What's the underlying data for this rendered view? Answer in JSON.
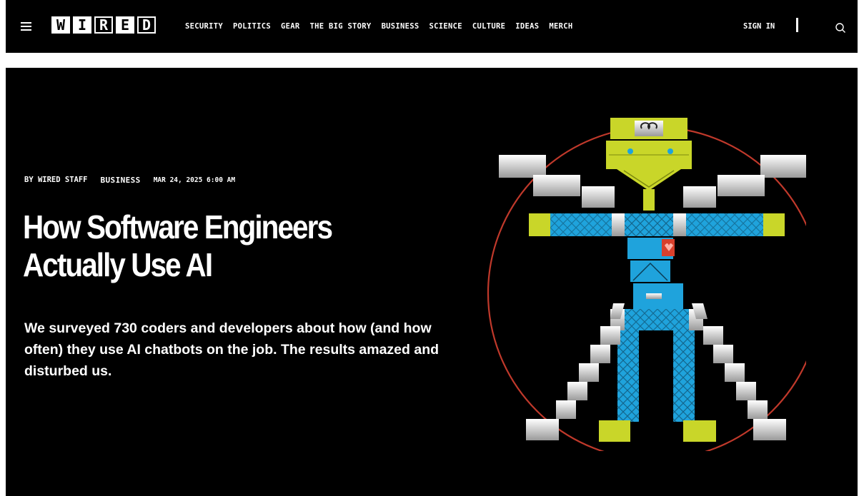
{
  "header": {
    "logo_letters": [
      "W",
      "I",
      "R",
      "E",
      "D"
    ],
    "nav_items": [
      "SECURITY",
      "POLITICS",
      "GEAR",
      "THE BIG STORY",
      "BUSINESS",
      "SCIENCE",
      "CULTURE",
      "IDEAS",
      "MERCH"
    ],
    "sign_in": "SIGN IN",
    "icons": [
      "menu-icon",
      "search-icon"
    ]
  },
  "article": {
    "byline": "BY WIRED STAFF",
    "rubric": "BUSINESS",
    "date": "MAR 24, 2025 6:00 AM",
    "headline": "How Software Engineers Actually Use AI",
    "dek": "We surveyed 730 coders and developers about how (and how often) they use AI chatbots on the job. The results amazed and disturbed us."
  },
  "colors": {
    "background": "#000000",
    "text": "#ffffff",
    "illustration_blue": "#1fa3dc",
    "illustration_yellow": "#c9d629",
    "illustration_red": "#d8402c",
    "circle": "#c0392b"
  }
}
